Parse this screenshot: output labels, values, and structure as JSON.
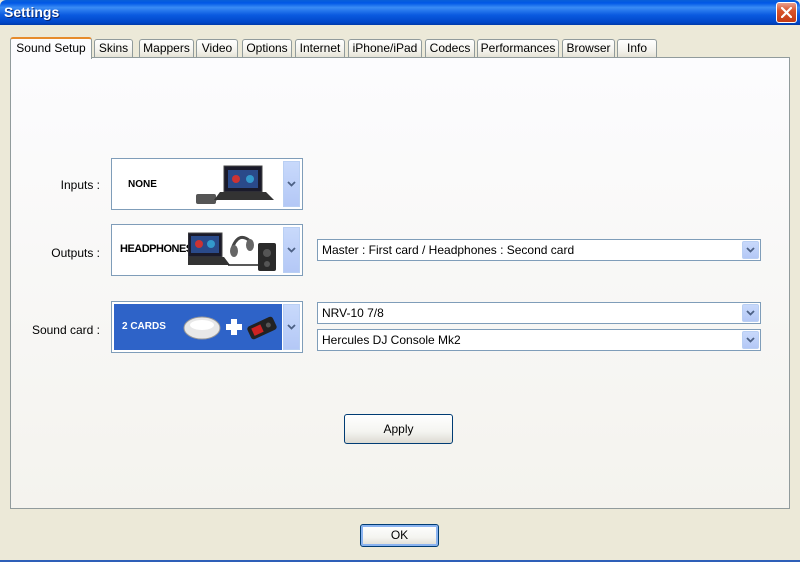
{
  "window": {
    "title": "Settings"
  },
  "tabs": [
    {
      "label": "Sound Setup",
      "active": true
    },
    {
      "label": "Skins"
    },
    {
      "label": "Mappers"
    },
    {
      "label": "Video"
    },
    {
      "label": "Options"
    },
    {
      "label": "Internet"
    },
    {
      "label": "iPhone/iPad"
    },
    {
      "label": "Codecs"
    },
    {
      "label": "Performances"
    },
    {
      "label": "Browser"
    },
    {
      "label": "Info"
    }
  ],
  "sound_setup": {
    "inputs": {
      "label": "Inputs :",
      "image_text": "NONE"
    },
    "outputs": {
      "label": "Outputs :",
      "image_text": "HEADPHONES",
      "mode_value": "Master : First card / Headphones : Second card"
    },
    "soundcard": {
      "label": "Sound card :",
      "image_text": "2 CARDS",
      "card1_value": "NRV-10 7/8",
      "card2_value": "Hercules DJ Console Mk2"
    },
    "apply_label": "Apply"
  },
  "footer": {
    "ok_label": "OK"
  },
  "colors": {
    "titlebar": "#0058e6",
    "tab_highlight": "#e68b2c",
    "selected_image_bg": "#2e63c8"
  }
}
